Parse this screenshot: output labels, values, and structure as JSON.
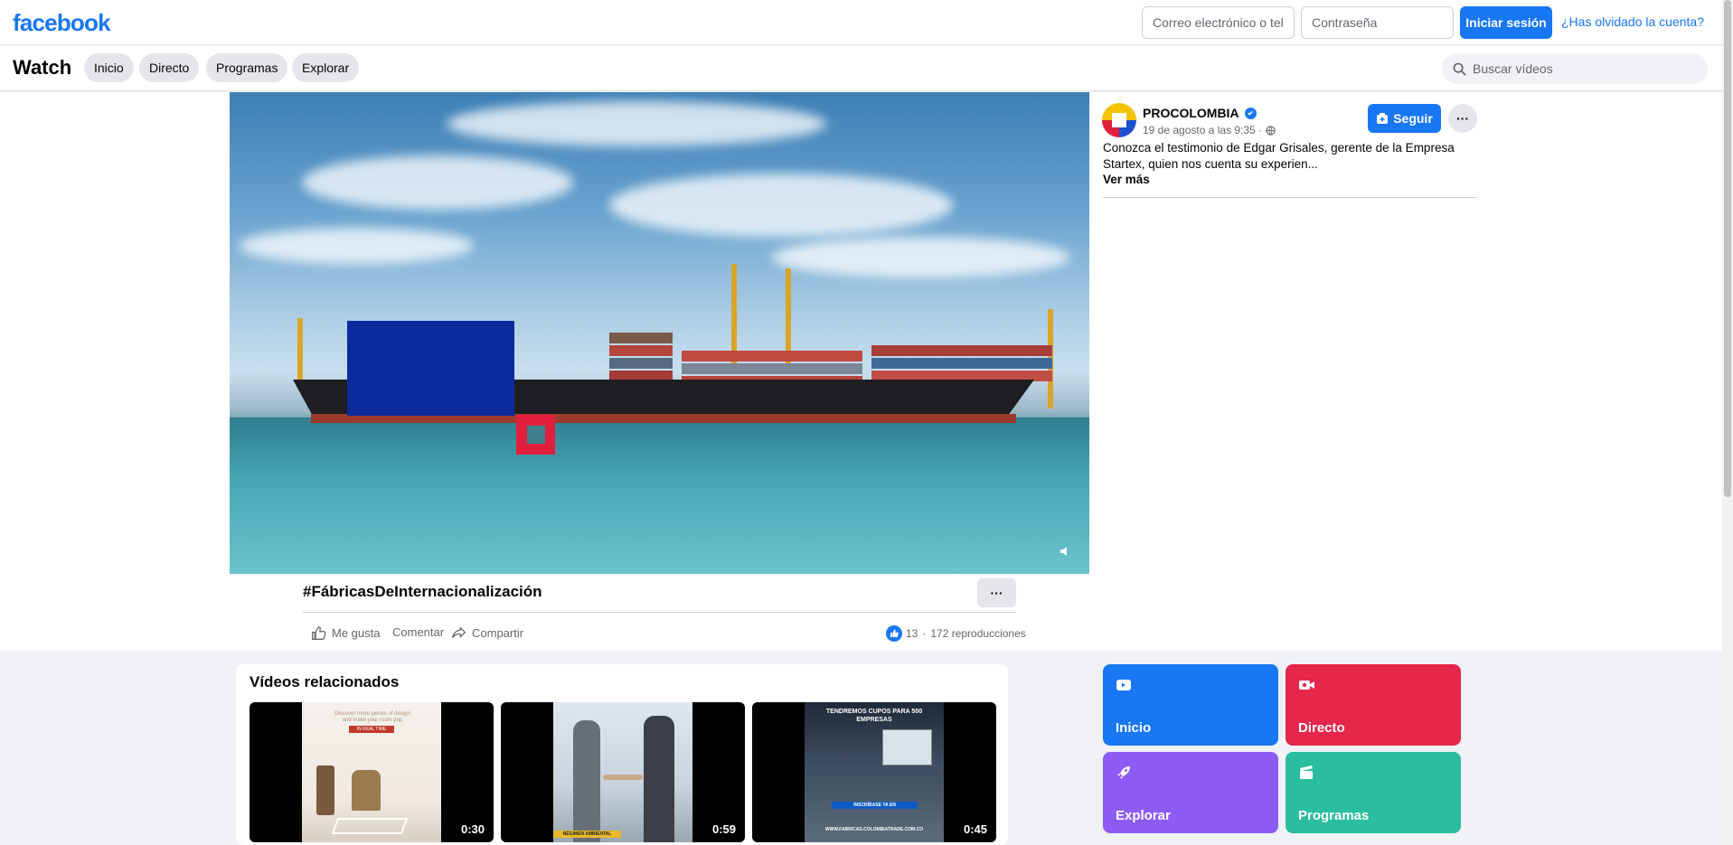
{
  "topbar": {
    "logo": "facebook",
    "email_placeholder": "Correo electrónico o tel",
    "password_placeholder": "Contraseña",
    "login_label": "Iniciar sesión",
    "forgot_label": "¿Has olvidado la cuenta?"
  },
  "watch": {
    "title": "Watch",
    "tabs": [
      {
        "label": "Inicio"
      },
      {
        "label": "Directo"
      },
      {
        "label": "Programas"
      },
      {
        "label": "Explorar"
      }
    ],
    "search_placeholder": "Buscar vídeos"
  },
  "video": {
    "title": "#FábricasDeInternacionalización",
    "more_label": "···",
    "actions": {
      "like": "Me gusta",
      "comment": "Comentar",
      "share": "Compartir"
    },
    "likes": "13",
    "views": "172 reproducciones"
  },
  "post": {
    "page_name": "PROCOLOMBIA",
    "date": "19 de agosto a las 9:35 ·",
    "follow_label": "Seguir",
    "more_label": "···",
    "text": "Conozca el testimonio de Edgar Grisales, gerente de la Empresa Startex, quien nos cuenta su experien...",
    "see_more": "Ver más"
  },
  "related": {
    "title": "Vídeos relacionados",
    "items": [
      {
        "duration": "0:30",
        "caption_1": "Discover more pieces of design",
        "caption_2": "and make your room pop",
        "badge": "IN REAL TIME"
      },
      {
        "duration": "0:59",
        "badge": "RÉGIMEN AMBIENTAL"
      },
      {
        "duration": "0:45",
        "headline": "TENDREMOS CUPOS PARA 500 EMPRESAS",
        "cta": "INSCRÍBASE YA EN",
        "url": "WWW.FABRICAS.COLOMBIATRADE.COM.CO"
      }
    ]
  },
  "nav_tiles": [
    {
      "label": "Inicio",
      "color": "#1877f2",
      "icon": "video-icon"
    },
    {
      "label": "Directo",
      "color": "#e4274a",
      "icon": "live-icon"
    },
    {
      "label": "Explorar",
      "color": "#8c5cf5",
      "icon": "rocket-icon"
    },
    {
      "label": "Programas",
      "color": "#2bbd9f",
      "icon": "clapper-icon"
    }
  ]
}
